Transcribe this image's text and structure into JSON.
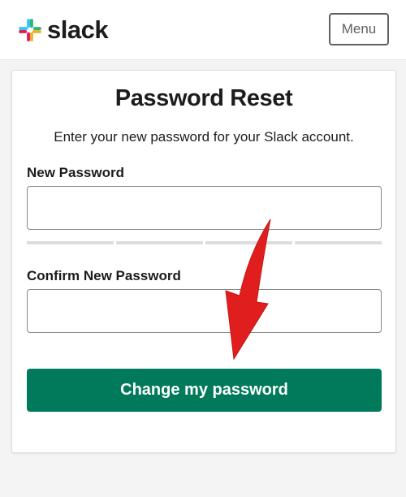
{
  "header": {
    "logo_text": "slack",
    "logo_icon": "slack-hash-icon",
    "menu_label": "Menu"
  },
  "form": {
    "title": "Password Reset",
    "subtitle": "Enter your new password for your  Slack account.",
    "new_password_label": "New Password",
    "new_password_value": "",
    "confirm_password_label": "Confirm New Password",
    "confirm_password_value": "",
    "strength_segments": 4,
    "submit_label": "Change my password"
  },
  "annotation": {
    "arrow_icon": "red-arrow-pointer",
    "arrow_color": "#e01e1e"
  },
  "colors": {
    "primary_button": "#007a5a",
    "slack_blue": "#36c5f0",
    "slack_green": "#2eb67d",
    "slack_yellow": "#ecb22e",
    "slack_red": "#e01e5a"
  }
}
